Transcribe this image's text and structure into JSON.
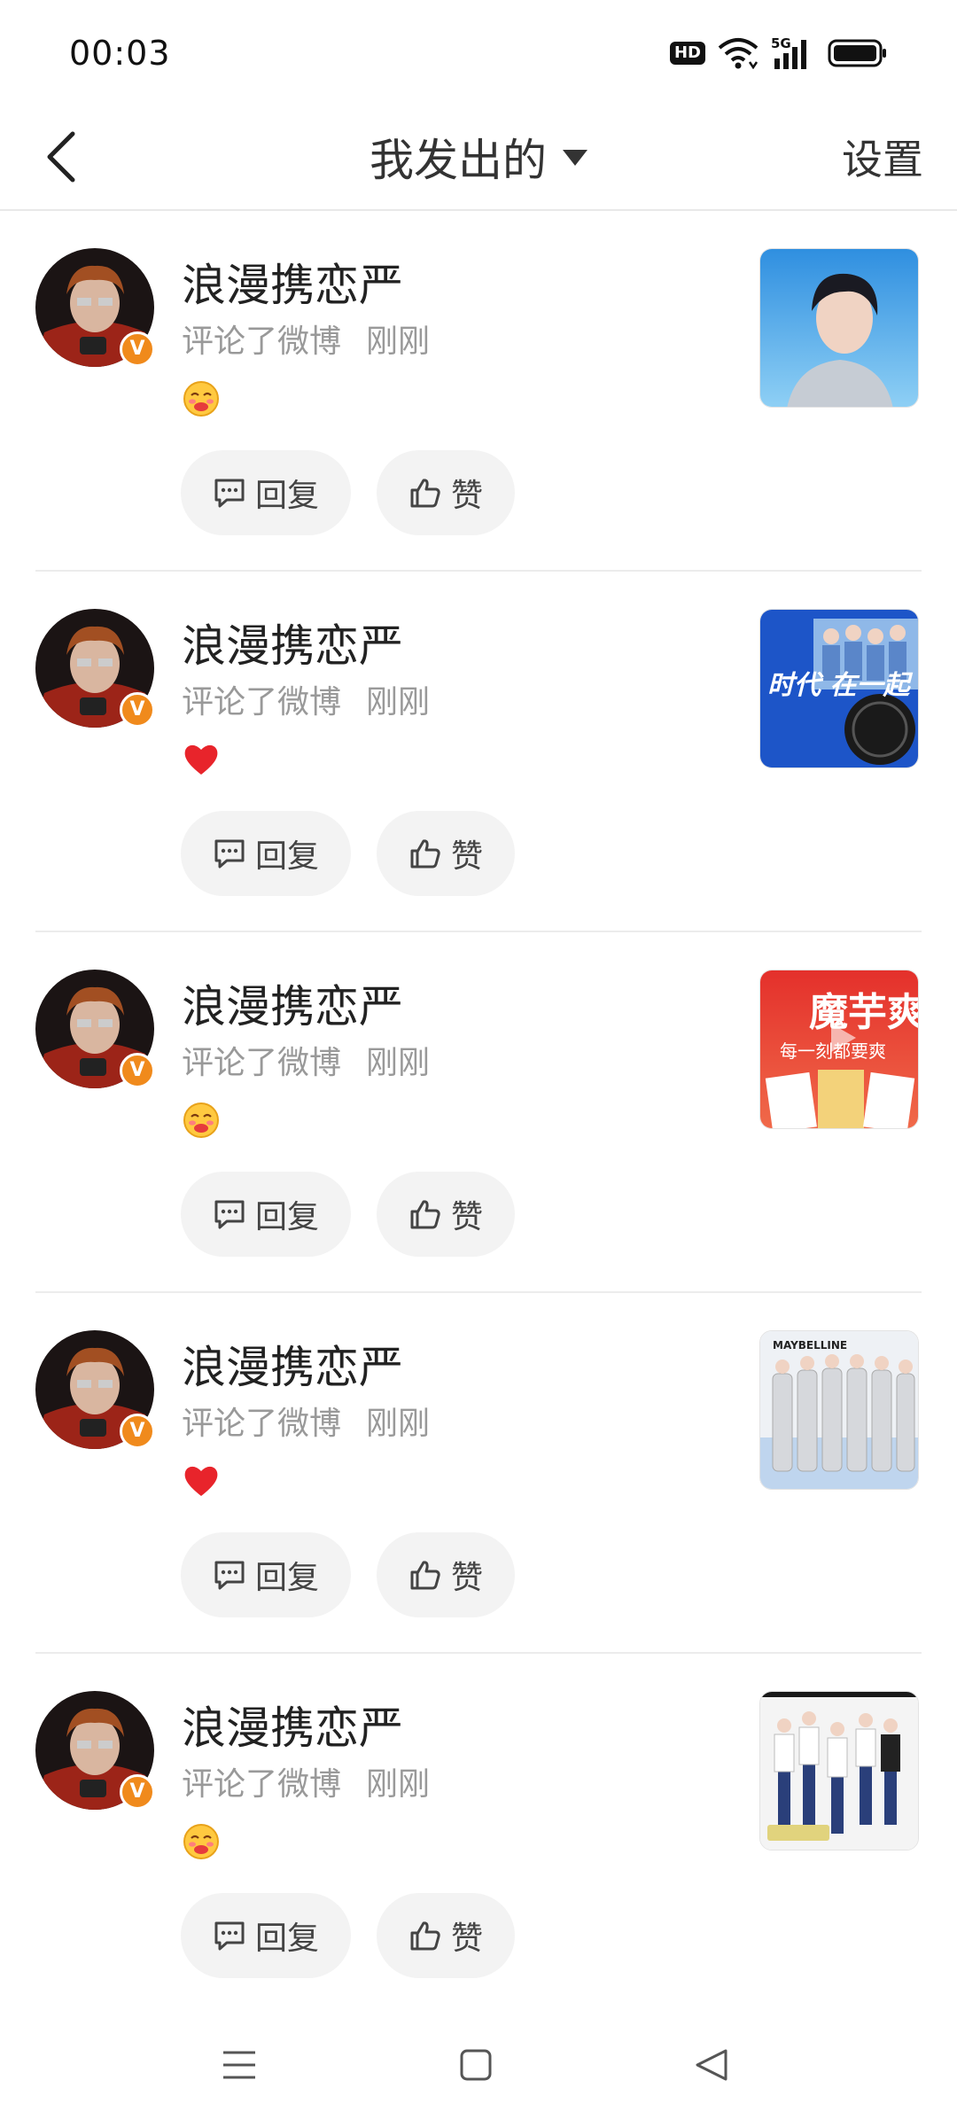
{
  "status_bar": {
    "time": "00:03",
    "hd_label": "HD",
    "network_label": "5G"
  },
  "nav": {
    "title": "我发出的",
    "settings_label": "设置"
  },
  "colors": {
    "accent_orange": "#f08a1c",
    "heart_red": "#e8242b",
    "meta_gray": "#999999",
    "button_bg": "#f3f3f3"
  },
  "actions": {
    "reply_label": "回复",
    "like_label": "赞"
  },
  "items": [
    {
      "username": "浪漫携恋严",
      "action": "评论了微博",
      "time": "刚刚",
      "emoji": "blush-hug-emoji-icon"
    },
    {
      "username": "浪漫携恋严",
      "action": "评论了微博",
      "time": "刚刚",
      "emoji": "red-heart-icon"
    },
    {
      "username": "浪漫携恋严",
      "action": "评论了微博",
      "time": "刚刚",
      "emoji": "blush-hug-emoji-icon"
    },
    {
      "username": "浪漫携恋严",
      "action": "评论了微博",
      "time": "刚刚",
      "emoji": "red-heart-icon"
    },
    {
      "username": "浪漫携恋严",
      "action": "评论了微博",
      "time": "刚刚",
      "emoji": "blush-hug-emoji-icon"
    }
  ],
  "thumbnails": [
    {
      "text": "",
      "subject": "portrait-photo"
    },
    {
      "text": "时代 在一起",
      "subject": "cookie-ad-group-photo"
    },
    {
      "text": "魔芋爽",
      "subtext": "每一刻都要爽",
      "subject": "snack-ad"
    },
    {
      "text": "MAYBELLINE",
      "subject": "group-photo-white-suits"
    },
    {
      "text": "",
      "subject": "dance-group-video"
    }
  ]
}
